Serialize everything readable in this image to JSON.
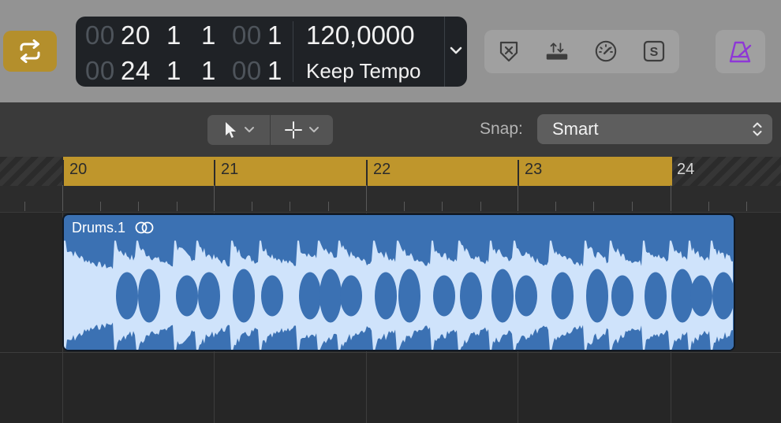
{
  "transport": {
    "cycle_active": true,
    "lcd": {
      "start": {
        "dim_bar": "00",
        "bar": "20",
        "beat": "1",
        "division": "1",
        "dim_tick": "00",
        "tick": "1"
      },
      "end": {
        "dim_bar": "00",
        "bar": "24",
        "beat": "1",
        "division": "1",
        "dim_tick": "00",
        "tick": "1"
      },
      "tempo": "120,0000",
      "tempo_mode": "Keep Tempo"
    }
  },
  "toolbar": {
    "buttons": [
      "replace-icon",
      "autopunch-icon",
      "tuner-icon",
      "solo-icon"
    ],
    "metronome_color": "#8a2be2"
  },
  "sub_toolbar": {
    "snap_label": "Snap:",
    "snap_value": "Smart"
  },
  "ruler": {
    "bars": [
      "20",
      "21",
      "22",
      "23",
      "24"
    ]
  },
  "region": {
    "name": "Drums.1",
    "color": "#3b71b3",
    "wave_color": "#cfe3fb"
  },
  "colors": {
    "cycle": "#bf962c",
    "cycle_button": "#b48f2c"
  }
}
